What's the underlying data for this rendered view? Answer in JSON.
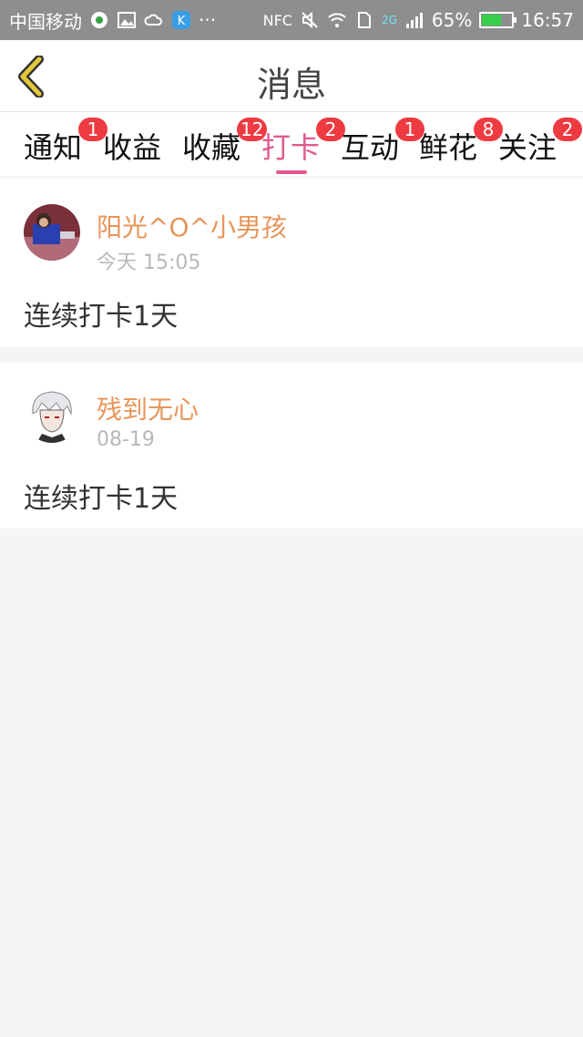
{
  "status_bar": {
    "carrier": "中国移动",
    "more": "···",
    "nfc": "NFC",
    "network": "2G",
    "battery": "65%",
    "battery_level": 0.65,
    "time": "16:57"
  },
  "header": {
    "title": "消息"
  },
  "tabs": [
    {
      "label": "通知",
      "badge": "1"
    },
    {
      "label": "收益",
      "badge": ""
    },
    {
      "label": "收藏",
      "badge": "12"
    },
    {
      "label": "打卡",
      "badge": "2",
      "active": true
    },
    {
      "label": "互动",
      "badge": "1"
    },
    {
      "label": "鲜花",
      "badge": "8"
    },
    {
      "label": "关注",
      "badge": "2"
    }
  ],
  "messages": [
    {
      "name": "阳光^O^小男孩",
      "time": "今天 15:05",
      "content": "连续打卡1天"
    },
    {
      "name": "残到无心",
      "time": "08-19",
      "content": "连续打卡1天"
    }
  ],
  "colors": {
    "accent": "#e05b8f",
    "badge": "#ee3b42",
    "username": "#e8955a",
    "back_icon": "#e2c83a"
  }
}
